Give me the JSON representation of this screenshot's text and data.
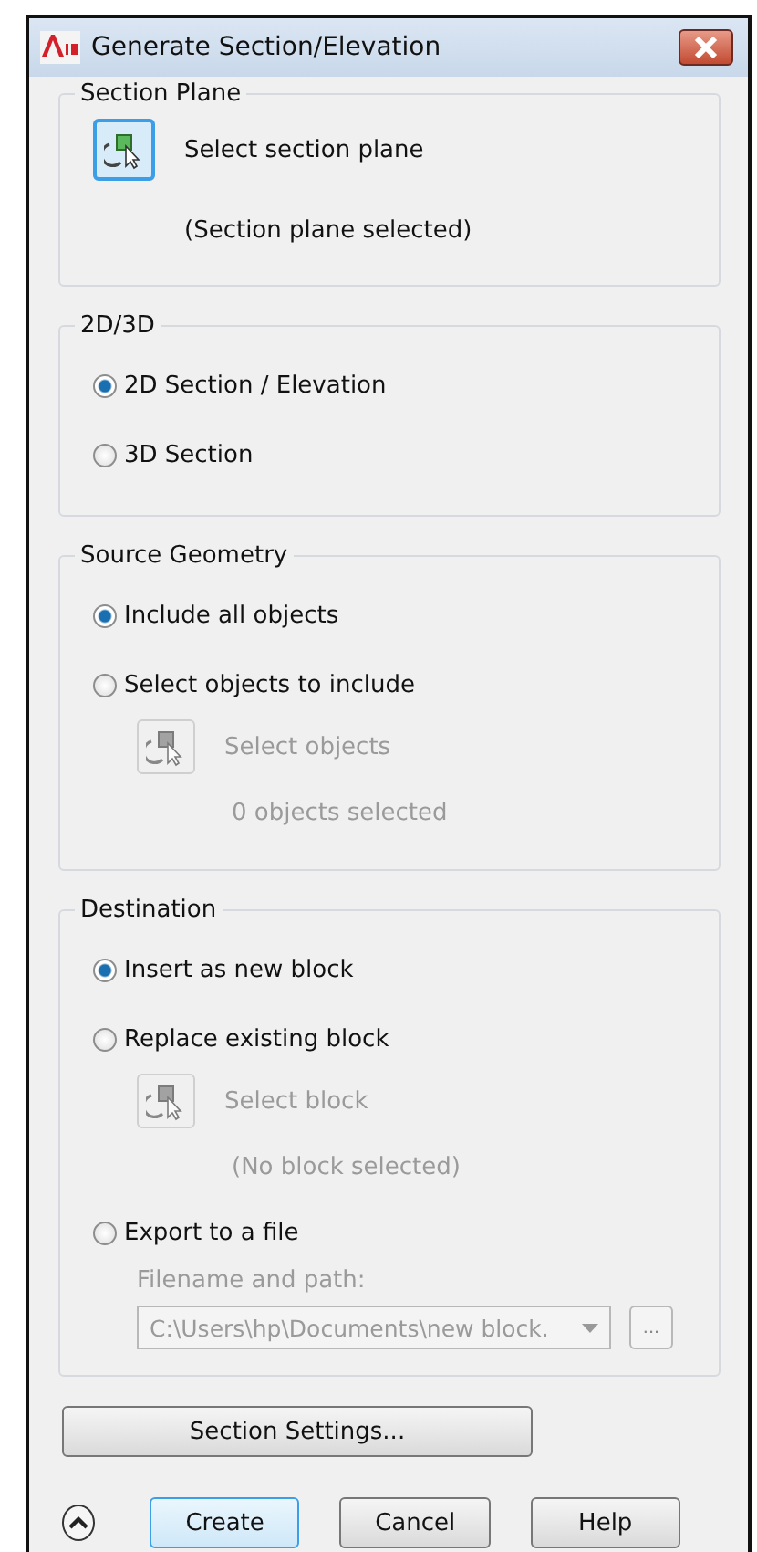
{
  "window": {
    "title": "Generate Section/Elevation"
  },
  "section_plane": {
    "title": "Section Plane",
    "action": "Select section plane",
    "status": "(Section plane selected)"
  },
  "mode": {
    "title": "2D/3D",
    "options": [
      {
        "label": "2D Section / Elevation",
        "selected": true
      },
      {
        "label": "3D Section",
        "selected": false
      }
    ]
  },
  "source_geometry": {
    "title": "Source Geometry",
    "options": [
      {
        "label": "Include all objects",
        "selected": true
      },
      {
        "label": "Select objects to include",
        "selected": false,
        "pick": {
          "label": "Select objects",
          "status": "0 objects selected",
          "disabled": true
        }
      }
    ]
  },
  "destination": {
    "title": "Destination",
    "options": [
      {
        "label": "Insert as new block",
        "selected": true
      },
      {
        "label": "Replace existing block",
        "selected": false,
        "pick": {
          "label": "Select block",
          "status": "(No block selected)",
          "disabled": true
        }
      },
      {
        "label": "Export to a file",
        "selected": false,
        "file": {
          "label": "Filename and path:",
          "value": "C:\\Users\\hp\\Documents\\new block.",
          "browse": "...",
          "disabled": true
        }
      }
    ]
  },
  "settings_button": "Section Settings...",
  "buttons": [
    {
      "label": "Create",
      "selected": true
    },
    {
      "label": "Cancel",
      "selected": false
    },
    {
      "label": "Help",
      "selected": false
    }
  ]
}
